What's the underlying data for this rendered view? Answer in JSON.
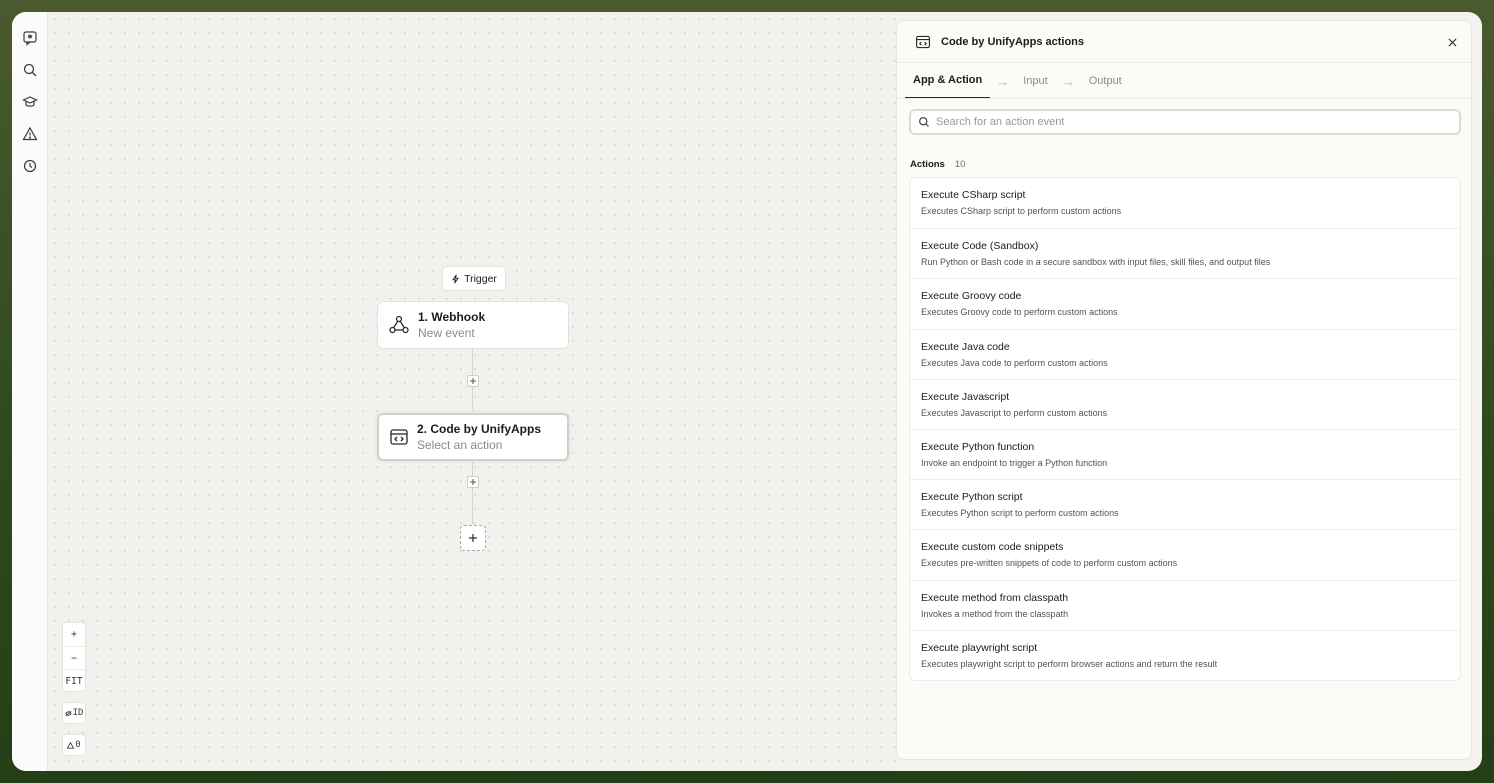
{
  "canvas": {
    "trigger_label": "Trigger",
    "nodes": [
      {
        "title": "1. Webhook",
        "subtitle": "New event"
      },
      {
        "title": "2. Code by UnifyApps",
        "subtitle": "Select an action"
      }
    ],
    "zoom": {
      "in": "+",
      "out": "−",
      "fit": "FIT"
    },
    "id_toggle": "ID",
    "warnings_count": "0"
  },
  "panel": {
    "title": "Code by UnifyApps actions",
    "tabs": [
      {
        "label": "App & Action"
      },
      {
        "label": "Input"
      },
      {
        "label": "Output"
      }
    ],
    "search_placeholder": "Search for an action event",
    "actions_label": "Actions",
    "actions_count": "10",
    "actions": [
      {
        "title": "Execute CSharp script",
        "description": "Executes CSharp script to perform custom actions"
      },
      {
        "title": "Execute Code (Sandbox)",
        "description": "Run Python or Bash code in a secure sandbox with input files, skill files, and output files"
      },
      {
        "title": "Execute Groovy code",
        "description": "Executes Groovy code to perform custom actions"
      },
      {
        "title": "Execute Java code",
        "description": "Executes Java code to perform custom actions"
      },
      {
        "title": "Execute Javascript",
        "description": "Executes Javascript to perform custom actions"
      },
      {
        "title": "Execute Python function",
        "description": "Invoke an endpoint to trigger a Python function"
      },
      {
        "title": "Execute Python script",
        "description": "Executes Python script to perform custom actions"
      },
      {
        "title": "Execute custom code snippets",
        "description": "Executes pre-written snippets of code to perform custom actions"
      },
      {
        "title": "Execute method from classpath",
        "description": "Invokes a method from the classpath"
      },
      {
        "title": "Execute playwright script",
        "description": "Executes playwright script to perform browser actions and return the result"
      }
    ]
  }
}
